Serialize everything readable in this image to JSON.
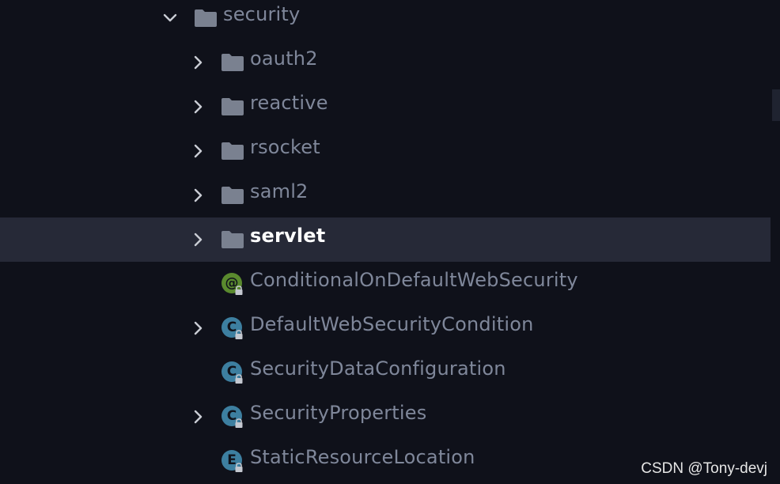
{
  "tree": {
    "root": {
      "label": "security",
      "expanded": true
    },
    "children": [
      {
        "label": "oauth2",
        "kind": "folder",
        "expandable": true
      },
      {
        "label": "reactive",
        "kind": "folder",
        "expandable": true
      },
      {
        "label": "rsocket",
        "kind": "folder",
        "expandable": true
      },
      {
        "label": "saml2",
        "kind": "folder",
        "expandable": true
      },
      {
        "label": "servlet",
        "kind": "folder",
        "expandable": true,
        "selected": true
      },
      {
        "label": "ConditionalOnDefaultWebSecurity",
        "kind": "annotation",
        "badge": "@",
        "badge_color": "#5a8a2e",
        "expandable": false
      },
      {
        "label": "DefaultWebSecurityCondition",
        "kind": "class",
        "badge": "C",
        "badge_color": "#3d7fa0",
        "expandable": true
      },
      {
        "label": "SecurityDataConfiguration",
        "kind": "class",
        "badge": "C",
        "badge_color": "#3d7fa0",
        "expandable": false
      },
      {
        "label": "SecurityProperties",
        "kind": "class",
        "badge": "C",
        "badge_color": "#3d7fa0",
        "expandable": true
      },
      {
        "label": "StaticResourceLocation",
        "kind": "enum",
        "badge": "E",
        "badge_color": "#3d7fa0",
        "expandable": false
      }
    ]
  },
  "watermark": "CSDN @Tony-devj",
  "colors": {
    "background": "#0f111a",
    "selection": "#262937",
    "text": "#7f879a",
    "selected_text": "#ffffff",
    "folder_icon": "#7a8190"
  }
}
